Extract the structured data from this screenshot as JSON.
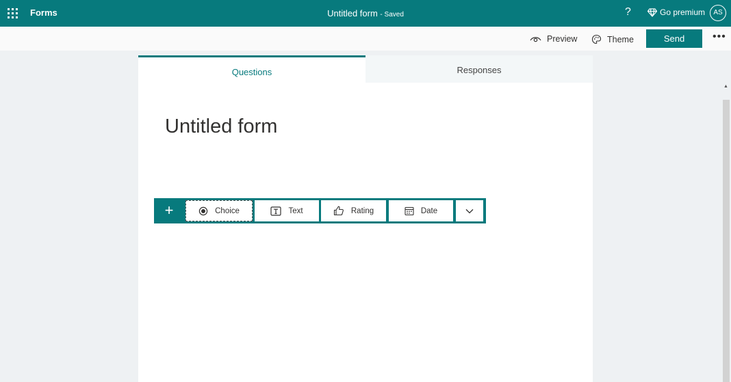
{
  "topbar": {
    "app_name": "Forms",
    "form_title": "Untitled form",
    "save_status": "- Saved",
    "help_label": "?",
    "premium_label": "Go premium",
    "avatar_initials": "AS"
  },
  "commandbar": {
    "preview_label": "Preview",
    "theme_label": "Theme",
    "send_label": "Send",
    "more_label": "•••"
  },
  "tabs": {
    "questions": "Questions",
    "responses": "Responses"
  },
  "form": {
    "title": "Untitled form"
  },
  "question_bar": {
    "add_label": "+",
    "choice": "Choice",
    "text": "Text",
    "rating": "Rating",
    "date": "Date"
  },
  "colors": {
    "brand": "#077a7d",
    "background": "#eef1f3"
  },
  "icons": {
    "apps": "waffle-icon",
    "premium": "diamond-icon",
    "preview": "eye-icon",
    "theme": "palette-icon",
    "choice": "radio-icon",
    "text": "text-box-icon",
    "rating": "thumbs-up-icon",
    "date": "calendar-icon",
    "more_types": "chevron-down-icon"
  }
}
